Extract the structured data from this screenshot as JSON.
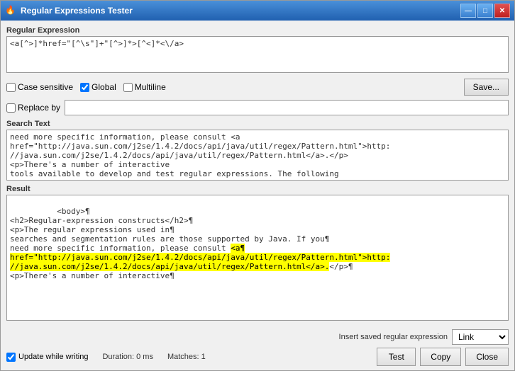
{
  "window": {
    "title": "Regular Expressions Tester",
    "icon": "🔥"
  },
  "title_buttons": {
    "minimize": "—",
    "maximize": "□",
    "close": "✕"
  },
  "sections": {
    "regex_label": "Regular Expression",
    "search_text_label": "Search Text",
    "result_label": "Result"
  },
  "regex_value": "<a[^>]*href=\"[^\\s\"]+\"[^>]*>[^<]*<\\/a>",
  "options": {
    "case_sensitive_label": "Case sensitive",
    "case_sensitive_checked": false,
    "global_label": "Global",
    "global_checked": true,
    "multiline_label": "Multiline",
    "multiline_checked": false,
    "save_label": "Save..."
  },
  "replace": {
    "label": "Replace by",
    "value": ""
  },
  "search_text": "need more specific information, please consult <a\nhref=\"http://java.sun.com/j2se/1.4.2/docs/api/java/util/regex/Pattern.html\">http:\n//java.sun.com/j2se/1.4.2/docs/api/java/util/regex/Pattern.html</a>.</p>\n<p>There's a number of interactive\ntools available to develop and test regular expressions. The following",
  "result_text": {
    "before_highlight": "<body>¶\n<h2>Regular-expression constructs</h2>¶\n<p>The regular expressions used in¶\nsearches and segmentation rules are those supported by Java. If you¶\nneed more specific information, please consult ",
    "highlight": "<a¶\nhref=\"http://java.sun.com/j2se/1.4.2/docs/api/java/util/regex/Pattern.html\">http:\n//java.sun.com/j2se/1.4.2/docs/api/java/util/regex/Pattern.html</a>.",
    "after_highlight": "</p>¶\n<p>There's a number of interactive¶"
  },
  "bottom": {
    "insert_label": "Insert saved regular expression",
    "insert_option": "Link",
    "insert_options": [
      "Link"
    ],
    "test_label": "Test",
    "copy_label": "Copy",
    "close_label": "Close"
  },
  "status": {
    "update_label": "Update while writing",
    "update_checked": true,
    "duration_label": "Duration: 0 ms",
    "matches_label": "Matches: 1"
  }
}
